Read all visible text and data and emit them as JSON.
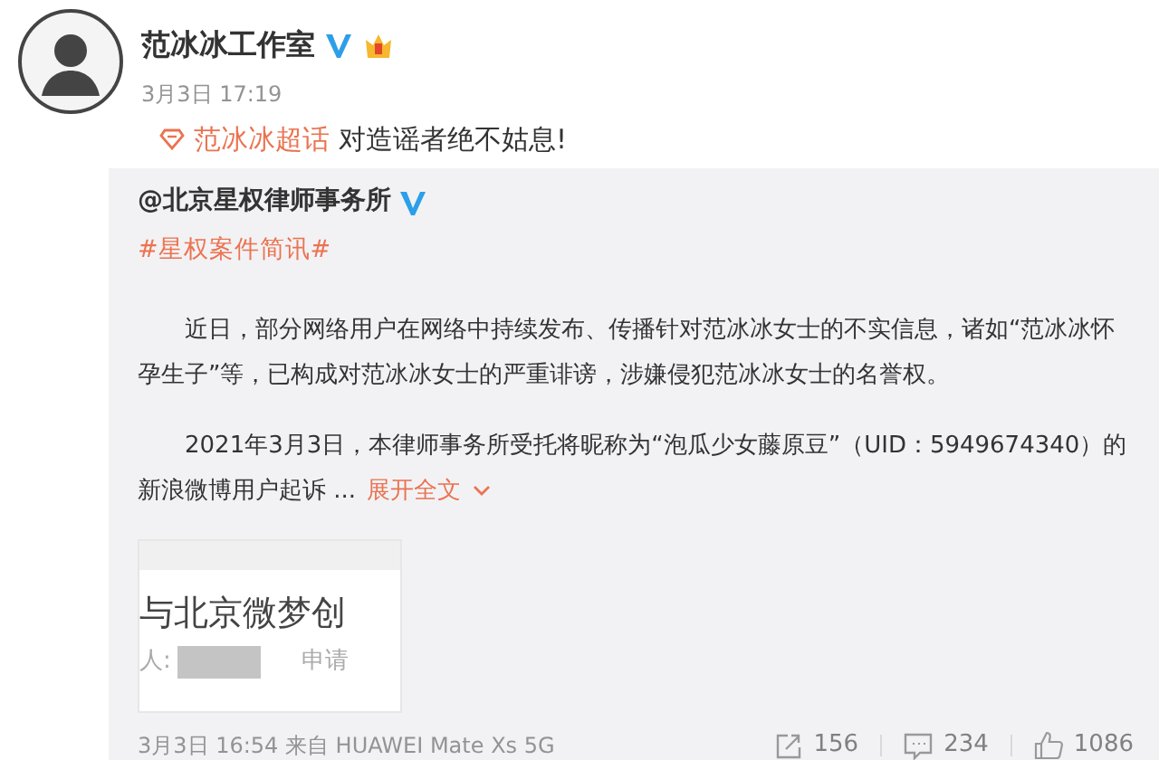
{
  "post": {
    "author": "范冰冰工作室",
    "verified": true,
    "time": "3月3日 17:19",
    "topic": "范冰冰超话",
    "text": "对造谣者绝不姑息!"
  },
  "repost": {
    "author": "@北京星权律师事务所",
    "verified": true,
    "hashtag": "#星权案件简讯#",
    "paragraphs": [
      "近日，部分网络用户在网络中持续发布、传播针对范冰冰女士的不实信息，诸如“范冰冰怀孕生子”等，已构成对范冰冰女士的严重诽谤，涉嫌侵犯范冰冰女士的名誉权。",
      "2021年3月3日，本律师事务所受托将昵称为“泡瓜少女藤原豆”（UID：5949674340）的新浪微博用户起诉 ..."
    ],
    "expand": "展开全文",
    "document": {
      "title": "与北京微梦创",
      "label": "人:",
      "field": "申请"
    },
    "footer": "3月3日 16:54 来自 HUAWEI Mate Xs 5G",
    "stats": [
      {
        "kind": "repost",
        "count": "156"
      },
      {
        "kind": "comment",
        "count": "234"
      },
      {
        "kind": "like",
        "count": "1086"
      }
    ]
  }
}
